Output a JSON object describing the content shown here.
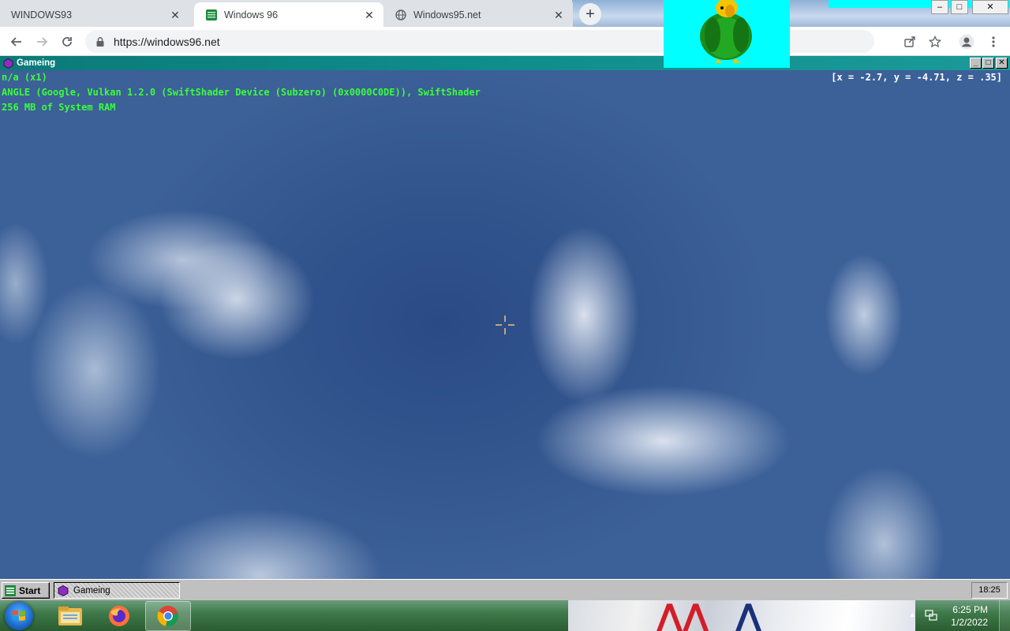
{
  "browser": {
    "tabs": [
      {
        "title": "WINDOWS93",
        "icon": "windows93-icon",
        "active": false
      },
      {
        "title": "Windows 96",
        "icon": "windows96-icon",
        "active": true
      },
      {
        "title": "Windows95.net",
        "icon": "globe-icon",
        "active": false
      }
    ],
    "new_tab_label": "+",
    "url": "https://windows96.net",
    "close_glyph": "✕"
  },
  "game_window": {
    "title": "Gameing",
    "controls": {
      "minimize": "_",
      "maximize": "□",
      "close": "✕"
    },
    "hud": {
      "line1": "n/a (x1)",
      "line2": "ANGLE (Google, Vulkan 1.2.0 (SwiftShader Device (Subzero) (0x0000C0DE)), SwiftShader",
      "line3": "256 MB of System RAM",
      "coords": "[x = -2.7, y = -4.71, z = .35]"
    }
  },
  "w96_taskbar": {
    "start_label": "Start",
    "task_label": "Gameing",
    "clock": "18:25"
  },
  "w7_taskbar": {
    "pinned": [
      "explorer-icon",
      "firefox-icon",
      "chrome-icon"
    ],
    "time": "6:25 PM",
    "date": "1/2/2022"
  },
  "colors": {
    "hud_green": "#39ff39",
    "title_teal": "#0e8c8a",
    "parrot_bg": "#00ffff",
    "sky": "#3c6098"
  }
}
